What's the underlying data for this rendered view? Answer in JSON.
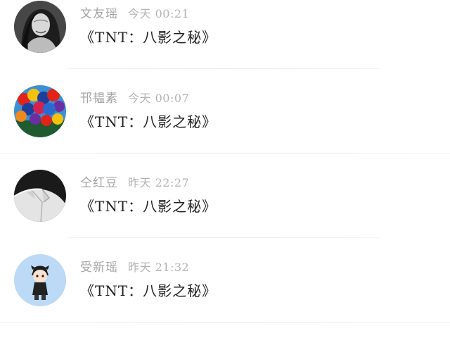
{
  "comments": [
    {
      "name": "文友瑶",
      "time": "今天 00:21",
      "text": "《TNT：八影之秘》",
      "avatar": "woman-portrait-avatar"
    },
    {
      "name": "邗韫素",
      "time": "今天 00:07",
      "text": "《TNT：八影之秘》",
      "avatar": "balloons-avatar"
    },
    {
      "name": "仝红豆",
      "time": "昨天 22:27",
      "text": "《TNT：八影之秘》",
      "avatar": "white-shirt-avatar"
    },
    {
      "name": "受新瑶",
      "time": "昨天 21:32",
      "text": "《TNT：八影之秘》",
      "avatar": "cartoon-boy-avatar"
    }
  ],
  "colors": {
    "name": "#a3a3a3",
    "time": "#b3b3b3",
    "text": "#222222",
    "divider": "#ececec"
  }
}
